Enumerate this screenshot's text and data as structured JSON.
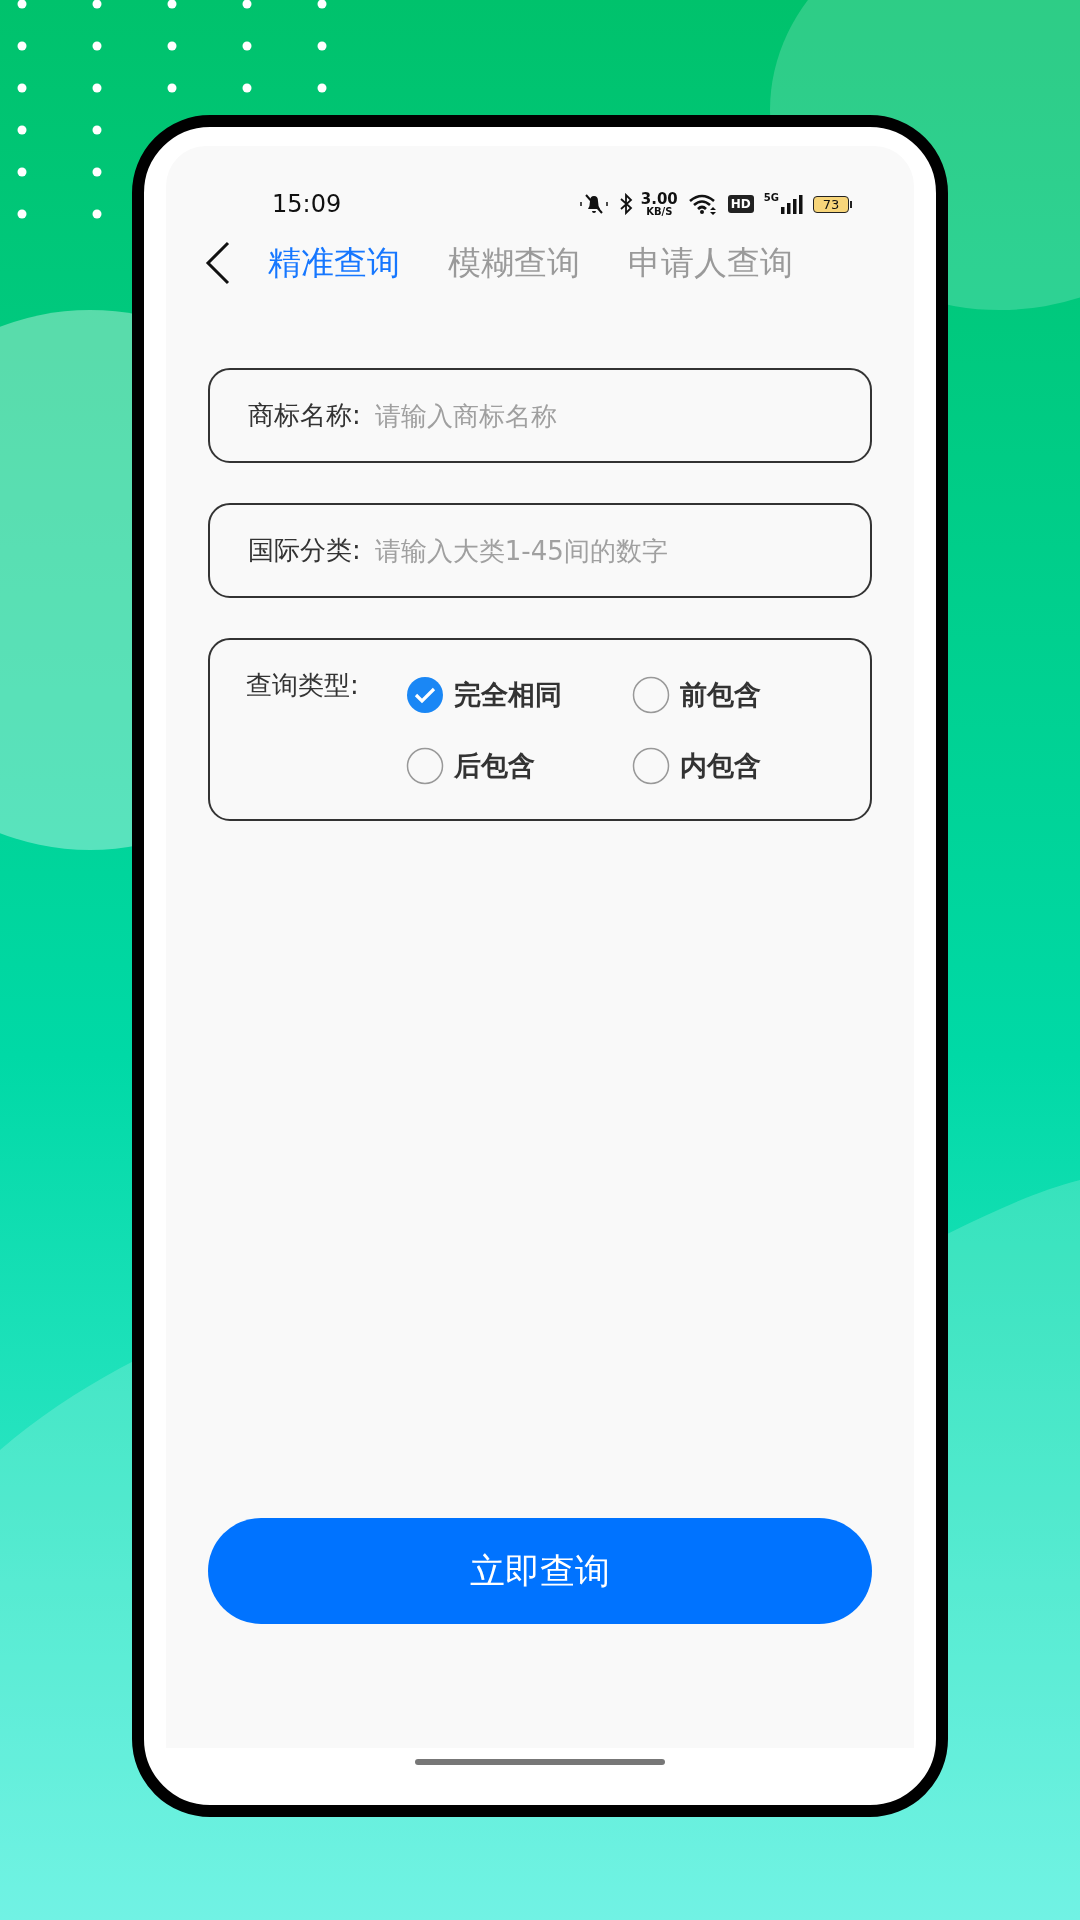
{
  "status_bar": {
    "time": "15:09",
    "speed_value": "3.00",
    "speed_unit": "KB/S",
    "hd_label": "HD",
    "network_label": "5G",
    "battery": "73"
  },
  "tabs": [
    {
      "label": "精准查询",
      "selected": true
    },
    {
      "label": "模糊查询",
      "selected": false
    },
    {
      "label": "申请人查询",
      "selected": false
    }
  ],
  "fields": [
    {
      "label": "商标名称:",
      "placeholder": "请输入商标名称"
    },
    {
      "label": "国际分类:",
      "placeholder": "请输入大类1-45间的数字"
    }
  ],
  "query_type": {
    "label": "查询类型:",
    "options": [
      {
        "label": "完全相同",
        "selected": true
      },
      {
        "label": "前包含",
        "selected": false
      },
      {
        "label": "后包含",
        "selected": false
      },
      {
        "label": "内包含",
        "selected": false
      }
    ]
  },
  "submit_button": "立即查询"
}
